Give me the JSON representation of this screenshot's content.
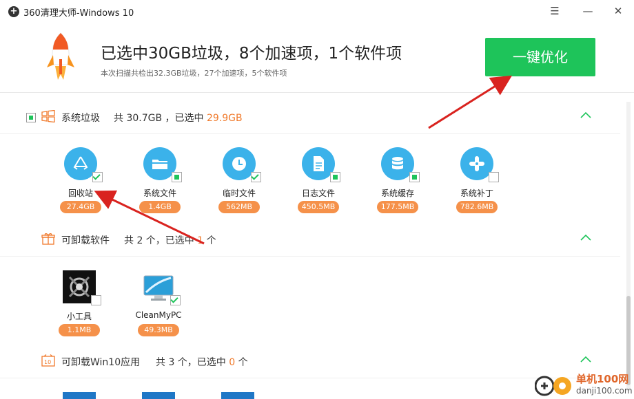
{
  "window": {
    "title": "360清理大师-Windows 10",
    "controls": [
      "☰",
      "—",
      "✕"
    ]
  },
  "header": {
    "headline": "已选中30GB垃圾，8个加速项，1个软件项",
    "subline": "本次扫描共检出32.3GB垃圾，27个加速项，5个软件项",
    "button_label": "一键优化"
  },
  "sections": {
    "junk": {
      "title": "系统垃圾",
      "info_prefix": "共 30.7GB ，已选中 ",
      "info_selected": "29.9GB",
      "items": [
        {
          "label": "回收站",
          "size": "27.4GB",
          "icon": "recycle-icon",
          "checked": "full"
        },
        {
          "label": "系统文件",
          "size": "1.4GB",
          "icon": "folder-icon",
          "checked": "partial"
        },
        {
          "label": "临时文件",
          "size": "562MB",
          "icon": "clock-icon",
          "checked": "full"
        },
        {
          "label": "日志文件",
          "size": "450.5MB",
          "icon": "document-icon",
          "checked": "partial"
        },
        {
          "label": "系统缓存",
          "size": "177.5MB",
          "icon": "database-icon",
          "checked": "partial"
        },
        {
          "label": "系统补丁",
          "size": "782.6MB",
          "icon": "patch-icon",
          "checked": "none"
        }
      ]
    },
    "software": {
      "title": "可卸载软件",
      "info_prefix": "共 2 个，已选中 ",
      "info_selected": "1",
      "info_suffix": " 个",
      "items": [
        {
          "label": "小工具",
          "size": "1.1MB",
          "icon": "tool-app-icon",
          "checked": "none"
        },
        {
          "label": "CleanMyPC",
          "size": "49.3MB",
          "icon": "cleanmypc-icon",
          "checked": "full"
        }
      ]
    },
    "win10apps": {
      "title": "可卸载Win10应用",
      "info_prefix": "共 3 个，已选中 ",
      "info_selected": "0",
      "info_suffix": " 个"
    }
  },
  "watermark": {
    "site_name": "单机100网",
    "url": "danji100.com"
  },
  "colors": {
    "accent_green": "#1ec45a",
    "icon_blue": "#3bb2ea",
    "badge_orange": "#f5914a",
    "highlight_orange": "#f07a2c",
    "arrow_red": "#d9231f"
  }
}
